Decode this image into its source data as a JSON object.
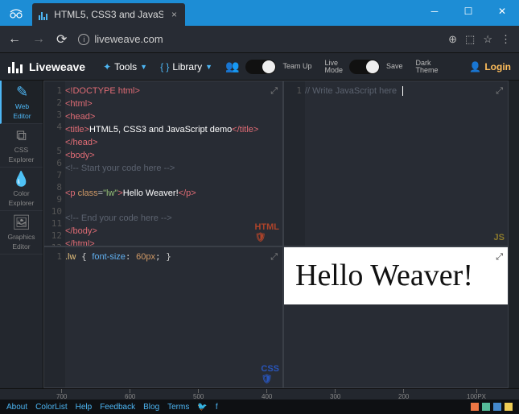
{
  "browser": {
    "tab_title": "HTML5, CSS3 and JavaSc",
    "url": "liveweave.com"
  },
  "toolbar": {
    "brand": "Liveweave",
    "tools": "Tools",
    "library": "Library",
    "teamup": "Team Up",
    "live_l1": "Live",
    "live_l2": "Mode",
    "save": "Save",
    "dark_l1": "Dark",
    "dark_l2": "Theme",
    "login": "Login"
  },
  "sidebar": {
    "web_l1": "Web",
    "web_l2": "Editor",
    "css_l1": "CSS",
    "css_l2": "Explorer",
    "color_l1": "Color",
    "color_l2": "Explorer",
    "gfx_l1": "Graphics",
    "gfx_l2": "Editor"
  },
  "code": {
    "html": {
      "l1": "<!DOCTYPE html>",
      "l2o": "<html>",
      "l3o": "<head>",
      "l4a": "<title>",
      "l4t": "HTML5, CSS3 and JavaScript demo",
      "l4b": "</title>",
      "l5c": "</head>",
      "l6o": "<body>",
      "l7": "<!-- Start your code here -->",
      "l9a": "<p ",
      "l9attr": "class",
      "l9eq": "=",
      "l9str": "\"lw\"",
      "l9b": ">",
      "l9t": "Hello Weaver!",
      "l9c": "</p>",
      "l11": "<!-- End your code here -->",
      "l12": "</body>",
      "l13": "</html>"
    },
    "css": ".lw { font-size: 60px; }",
    "js": "// Write JavaScript here"
  },
  "preview": {
    "text": "Hello Weaver!"
  },
  "ruler": {
    "t700": "700",
    "t600": "600",
    "t500": "500",
    "t400": "400",
    "t300": "300",
    "t200": "200",
    "t100": "100PX"
  },
  "footer": {
    "about": "About",
    "colorlist": "ColorList",
    "help": "Help",
    "feedback": "Feedback",
    "blog": "Blog",
    "terms": "Terms"
  },
  "chart_data": null
}
